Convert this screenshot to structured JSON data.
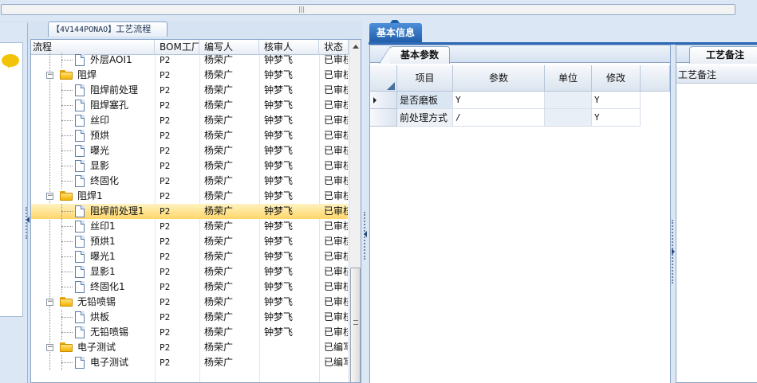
{
  "flow_tab": {
    "code": "【4V144PONAO】",
    "label": "工艺流程"
  },
  "tree": {
    "headers": [
      "流程",
      "BOM工厂",
      "编写人",
      "核审人",
      "状态"
    ],
    "rows": [
      {
        "name": "外层AOI1",
        "type": "doc",
        "level": 2,
        "bom": "P2",
        "writer": "杨荣广",
        "reviewer": "钟梦飞",
        "status": "已审核"
      },
      {
        "name": "阻焊",
        "type": "folder",
        "level": 1,
        "bom": "P2",
        "writer": "杨荣广",
        "reviewer": "钟梦飞",
        "status": "已审核"
      },
      {
        "name": "阻焊前处理",
        "type": "doc",
        "level": 2,
        "bom": "P2",
        "writer": "杨荣广",
        "reviewer": "钟梦飞",
        "status": "已审核"
      },
      {
        "name": "阻焊塞孔",
        "type": "doc",
        "level": 2,
        "bom": "P2",
        "writer": "杨荣广",
        "reviewer": "钟梦飞",
        "status": "已审核"
      },
      {
        "name": "丝印",
        "type": "doc",
        "level": 2,
        "bom": "P2",
        "writer": "杨荣广",
        "reviewer": "钟梦飞",
        "status": "已审核"
      },
      {
        "name": "预烘",
        "type": "doc",
        "level": 2,
        "bom": "P2",
        "writer": "杨荣广",
        "reviewer": "钟梦飞",
        "status": "已审核"
      },
      {
        "name": "曝光",
        "type": "doc",
        "level": 2,
        "bom": "P2",
        "writer": "杨荣广",
        "reviewer": "钟梦飞",
        "status": "已审核"
      },
      {
        "name": "显影",
        "type": "doc",
        "level": 2,
        "bom": "P2",
        "writer": "杨荣广",
        "reviewer": "钟梦飞",
        "status": "已审核"
      },
      {
        "name": "终固化",
        "type": "doc",
        "level": 2,
        "bom": "P2",
        "writer": "杨荣广",
        "reviewer": "钟梦飞",
        "status": "已审核"
      },
      {
        "name": "阻焊1",
        "type": "folder",
        "level": 1,
        "bom": "P2",
        "writer": "杨荣广",
        "reviewer": "钟梦飞",
        "status": "已审核"
      },
      {
        "name": "阻焊前处理1",
        "type": "doc",
        "level": 2,
        "bom": "P2",
        "writer": "杨荣广",
        "reviewer": "钟梦飞",
        "status": "已审核",
        "selected": true
      },
      {
        "name": "丝印1",
        "type": "doc",
        "level": 2,
        "bom": "P2",
        "writer": "杨荣广",
        "reviewer": "钟梦飞",
        "status": "已审核"
      },
      {
        "name": "预烘1",
        "type": "doc",
        "level": 2,
        "bom": "P2",
        "writer": "杨荣广",
        "reviewer": "钟梦飞",
        "status": "已审核"
      },
      {
        "name": "曝光1",
        "type": "doc",
        "level": 2,
        "bom": "P2",
        "writer": "杨荣广",
        "reviewer": "钟梦飞",
        "status": "已审核"
      },
      {
        "name": "显影1",
        "type": "doc",
        "level": 2,
        "bom": "P2",
        "writer": "杨荣广",
        "reviewer": "钟梦飞",
        "status": "已审核"
      },
      {
        "name": "终固化1",
        "type": "doc",
        "level": 2,
        "bom": "P2",
        "writer": "杨荣广",
        "reviewer": "钟梦飞",
        "status": "已审核"
      },
      {
        "name": "无铅喷锡",
        "type": "folder",
        "level": 1,
        "bom": "P2",
        "writer": "杨荣广",
        "reviewer": "钟梦飞",
        "status": "已审核"
      },
      {
        "name": "烘板",
        "type": "doc",
        "level": 2,
        "bom": "P2",
        "writer": "杨荣广",
        "reviewer": "钟梦飞",
        "status": "已审核"
      },
      {
        "name": "无铅喷锡",
        "type": "doc",
        "level": 2,
        "bom": "P2",
        "writer": "杨荣广",
        "reviewer": "钟梦飞",
        "status": "已审核"
      },
      {
        "name": "电子测试",
        "type": "folder",
        "level": 1,
        "bom": "P2",
        "writer": "杨荣广",
        "reviewer": "",
        "status": "已编写"
      },
      {
        "name": "电子测试",
        "type": "doc",
        "level": 2,
        "bom": "P2",
        "writer": "杨荣广",
        "reviewer": "",
        "status": "已编写"
      }
    ]
  },
  "basic_info": {
    "tab_label": "基本信息"
  },
  "params": {
    "tab_label": "基本参数",
    "headers": [
      "项目",
      "参数",
      "单位",
      "修改"
    ],
    "rows": [
      {
        "item": "是否磨板",
        "value": "Y",
        "unit": "",
        "modify": "Y",
        "current": true
      },
      {
        "item": "前处理方式",
        "value": "/",
        "unit": "",
        "modify": "Y",
        "current": false
      }
    ]
  },
  "notes": {
    "tab_label": "工艺备注",
    "column_label": "工艺备注"
  }
}
